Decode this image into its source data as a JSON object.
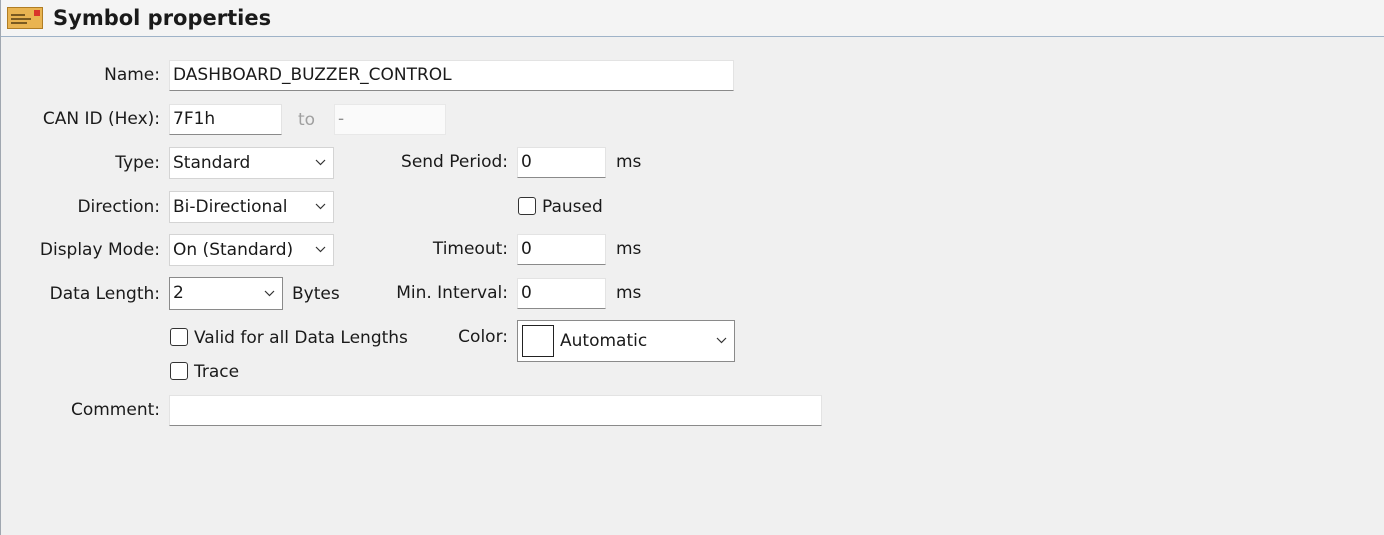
{
  "header": {
    "title": "Symbol properties",
    "icon": "envelope-icon"
  },
  "form": {
    "name": {
      "label": "Name:",
      "value": "DASHBOARD_BUZZER_CONTROL"
    },
    "can_id": {
      "label": "CAN ID (Hex):",
      "value": "7F1h",
      "to_label": "to",
      "to_value": "-"
    },
    "type": {
      "label": "Type:",
      "value": "Standard"
    },
    "direction": {
      "label": "Direction:",
      "value": "Bi-Directional"
    },
    "display_mode": {
      "label": "Display Mode:",
      "value": "On (Standard)"
    },
    "data_length": {
      "label": "Data Length:",
      "value": "2",
      "unit": "Bytes"
    },
    "valid_all_lengths": {
      "label": "Valid for all Data Lengths",
      "checked": false
    },
    "trace": {
      "label": "Trace",
      "checked": false
    },
    "comment": {
      "label": "Comment:",
      "value": ""
    },
    "send_period": {
      "label": "Send Period:",
      "value": "0",
      "unit": "ms"
    },
    "paused": {
      "label": "Paused",
      "checked": false
    },
    "timeout": {
      "label": "Timeout:",
      "value": "0",
      "unit": "ms"
    },
    "min_interval": {
      "label": "Min. Interval:",
      "value": "0",
      "unit": "ms"
    },
    "color": {
      "label": "Color:",
      "value": "Automatic",
      "swatch": "#ffffff"
    }
  },
  "colors": {
    "background": "#f0f0f0",
    "header_border": "#9fb3c8",
    "icon_body": "#e8b04a",
    "icon_stamp": "#d9342b"
  }
}
